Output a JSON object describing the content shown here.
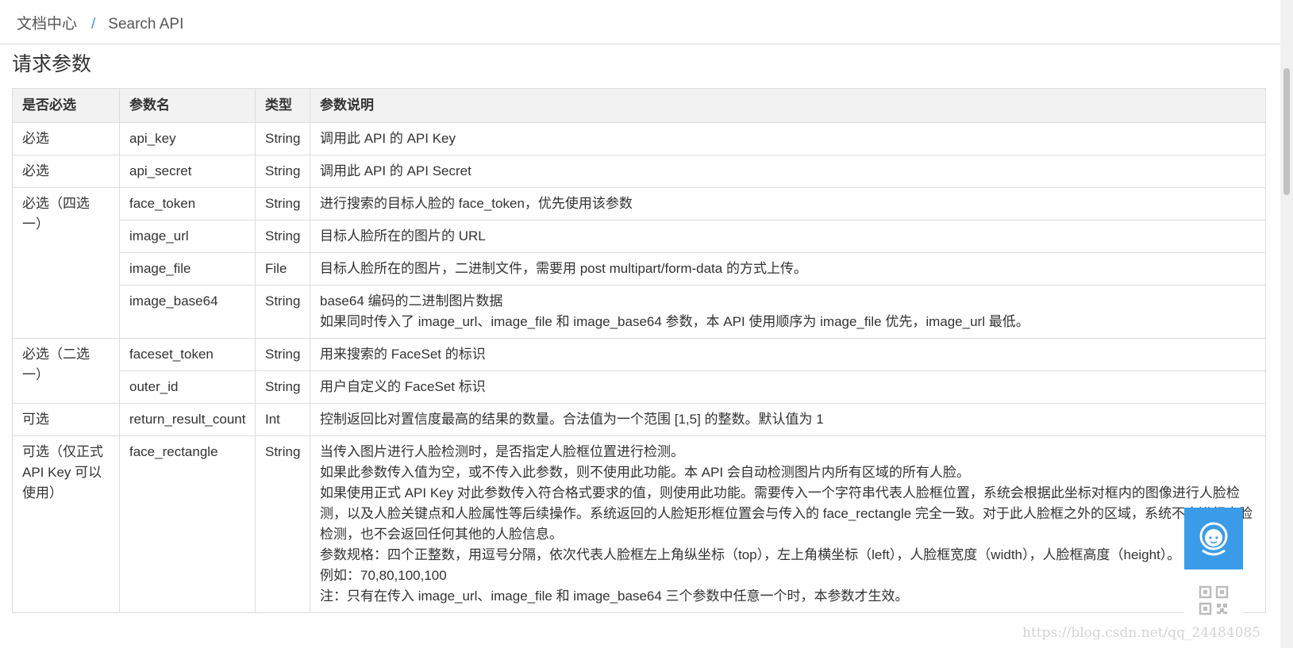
{
  "breadcrumb": {
    "root": "文档中心",
    "separator": "/",
    "current": "Search API"
  },
  "section": {
    "title": "请求参数"
  },
  "table": {
    "headers": [
      "是否必选",
      "参数名",
      "类型",
      "参数说明"
    ],
    "rows": [
      {
        "required": "必选",
        "name": "api_key",
        "type": "String",
        "desc": [
          "调用此 API 的 API Key"
        ]
      },
      {
        "required": "必选",
        "name": "api_secret",
        "type": "String",
        "desc": [
          "调用此 API 的 API Secret"
        ]
      },
      {
        "required": "必选（四选一）",
        "name": "face_token",
        "type": "String",
        "desc": [
          "进行搜索的目标人脸的 face_token，优先使用该参数"
        ]
      },
      {
        "name": "image_url",
        "type": "String",
        "desc": [
          "目标人脸所在的图片的 URL"
        ]
      },
      {
        "name": "image_file",
        "type": "File",
        "desc": [
          "目标人脸所在的图片，二进制文件，需要用 post multipart/form-data 的方式上传。"
        ]
      },
      {
        "name": "image_base64",
        "type": "String",
        "desc": [
          "base64 编码的二进制图片数据",
          "如果同时传入了 image_url、image_file 和 image_base64 参数，本 API 使用顺序为 image_file 优先，image_url 最低。"
        ]
      },
      {
        "required": "必选（二选一）",
        "name": "faceset_token",
        "type": "String",
        "desc": [
          "用来搜索的 FaceSet 的标识"
        ]
      },
      {
        "name": "outer_id",
        "type": "String",
        "desc": [
          "用户自定义的 FaceSet 标识"
        ]
      },
      {
        "required": "可选",
        "name": "return_result_count",
        "type": "Int",
        "desc": [
          "控制返回比对置信度最高的结果的数量。合法值为一个范围 [1,5] 的整数。默认值为 1"
        ]
      },
      {
        "required": "可选（仅正式 API Key 可以使用）",
        "name": "face_rectangle",
        "type": "String",
        "desc": [
          "当传入图片进行人脸检测时，是否指定人脸框位置进行检测。",
          "如果此参数传入值为空，或不传入此参数，则不使用此功能。本 API 会自动检测图片内所有区域的所有人脸。",
          "如果使用正式 API Key 对此参数传入符合格式要求的值，则使用此功能。需要传入一个字符串代表人脸框位置，系统会根据此坐标对框内的图像进行人脸检测，以及人脸关键点和人脸属性等后续操作。系统返回的人脸矩形框位置会与传入的 face_rectangle 完全一致。对于此人脸框之外的区域，系统不会进行人脸检测，也不会返回任何其他的人脸信息。",
          "参数规格：四个正整数，用逗号分隔，依次代表人脸框左上角纵坐标（top），左上角横坐标（left），人脸框宽度（width），人脸框高度（height）。",
          "例如：70,80,100,100",
          "注：只有在传入 image_url、image_file 和 image_base64 三个参数中任意一个时，本参数才生效。"
        ]
      }
    ]
  },
  "watermark": "https://blog.csdn.net/qq_24484085",
  "icons": {
    "support": "customer-service-icon",
    "qrcode": "qr-code-icon"
  },
  "colors": {
    "accent": "#3a9be8",
    "header_bg": "#f2f2f2",
    "border": "#dddddd"
  }
}
